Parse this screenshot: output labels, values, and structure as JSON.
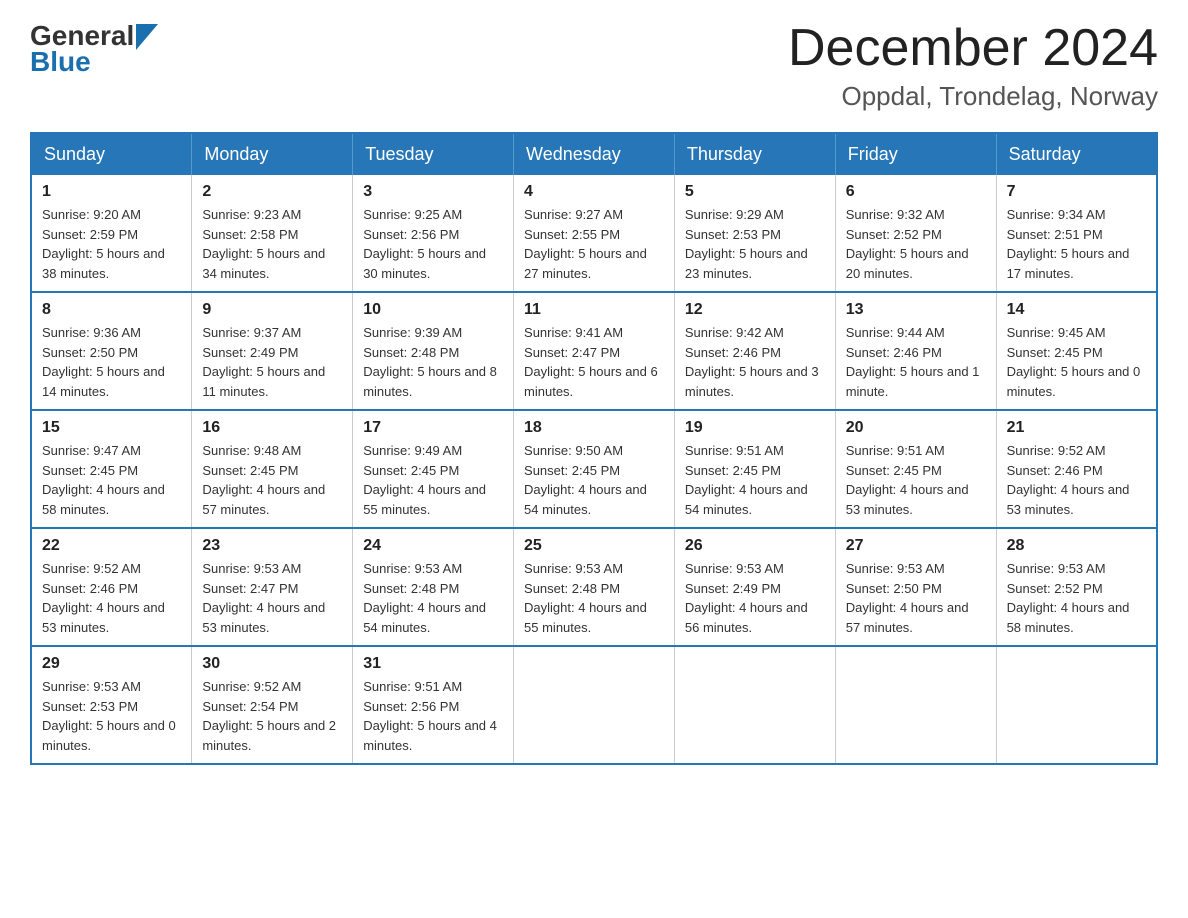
{
  "logo": {
    "general": "General",
    "blue": "Blue"
  },
  "title": {
    "month_year": "December 2024",
    "location": "Oppdal, Trondelag, Norway"
  },
  "weekdays": [
    "Sunday",
    "Monday",
    "Tuesday",
    "Wednesday",
    "Thursday",
    "Friday",
    "Saturday"
  ],
  "weeks": [
    [
      {
        "day": "1",
        "sunrise": "9:20 AM",
        "sunset": "2:59 PM",
        "daylight": "5 hours and 38 minutes."
      },
      {
        "day": "2",
        "sunrise": "9:23 AM",
        "sunset": "2:58 PM",
        "daylight": "5 hours and 34 minutes."
      },
      {
        "day": "3",
        "sunrise": "9:25 AM",
        "sunset": "2:56 PM",
        "daylight": "5 hours and 30 minutes."
      },
      {
        "day": "4",
        "sunrise": "9:27 AM",
        "sunset": "2:55 PM",
        "daylight": "5 hours and 27 minutes."
      },
      {
        "day": "5",
        "sunrise": "9:29 AM",
        "sunset": "2:53 PM",
        "daylight": "5 hours and 23 minutes."
      },
      {
        "day": "6",
        "sunrise": "9:32 AM",
        "sunset": "2:52 PM",
        "daylight": "5 hours and 20 minutes."
      },
      {
        "day": "7",
        "sunrise": "9:34 AM",
        "sunset": "2:51 PM",
        "daylight": "5 hours and 17 minutes."
      }
    ],
    [
      {
        "day": "8",
        "sunrise": "9:36 AM",
        "sunset": "2:50 PM",
        "daylight": "5 hours and 14 minutes."
      },
      {
        "day": "9",
        "sunrise": "9:37 AM",
        "sunset": "2:49 PM",
        "daylight": "5 hours and 11 minutes."
      },
      {
        "day": "10",
        "sunrise": "9:39 AM",
        "sunset": "2:48 PM",
        "daylight": "5 hours and 8 minutes."
      },
      {
        "day": "11",
        "sunrise": "9:41 AM",
        "sunset": "2:47 PM",
        "daylight": "5 hours and 6 minutes."
      },
      {
        "day": "12",
        "sunrise": "9:42 AM",
        "sunset": "2:46 PM",
        "daylight": "5 hours and 3 minutes."
      },
      {
        "day": "13",
        "sunrise": "9:44 AM",
        "sunset": "2:46 PM",
        "daylight": "5 hours and 1 minute."
      },
      {
        "day": "14",
        "sunrise": "9:45 AM",
        "sunset": "2:45 PM",
        "daylight": "5 hours and 0 minutes."
      }
    ],
    [
      {
        "day": "15",
        "sunrise": "9:47 AM",
        "sunset": "2:45 PM",
        "daylight": "4 hours and 58 minutes."
      },
      {
        "day": "16",
        "sunrise": "9:48 AM",
        "sunset": "2:45 PM",
        "daylight": "4 hours and 57 minutes."
      },
      {
        "day": "17",
        "sunrise": "9:49 AM",
        "sunset": "2:45 PM",
        "daylight": "4 hours and 55 minutes."
      },
      {
        "day": "18",
        "sunrise": "9:50 AM",
        "sunset": "2:45 PM",
        "daylight": "4 hours and 54 minutes."
      },
      {
        "day": "19",
        "sunrise": "9:51 AM",
        "sunset": "2:45 PM",
        "daylight": "4 hours and 54 minutes."
      },
      {
        "day": "20",
        "sunrise": "9:51 AM",
        "sunset": "2:45 PM",
        "daylight": "4 hours and 53 minutes."
      },
      {
        "day": "21",
        "sunrise": "9:52 AM",
        "sunset": "2:46 PM",
        "daylight": "4 hours and 53 minutes."
      }
    ],
    [
      {
        "day": "22",
        "sunrise": "9:52 AM",
        "sunset": "2:46 PM",
        "daylight": "4 hours and 53 minutes."
      },
      {
        "day": "23",
        "sunrise": "9:53 AM",
        "sunset": "2:47 PM",
        "daylight": "4 hours and 53 minutes."
      },
      {
        "day": "24",
        "sunrise": "9:53 AM",
        "sunset": "2:48 PM",
        "daylight": "4 hours and 54 minutes."
      },
      {
        "day": "25",
        "sunrise": "9:53 AM",
        "sunset": "2:48 PM",
        "daylight": "4 hours and 55 minutes."
      },
      {
        "day": "26",
        "sunrise": "9:53 AM",
        "sunset": "2:49 PM",
        "daylight": "4 hours and 56 minutes."
      },
      {
        "day": "27",
        "sunrise": "9:53 AM",
        "sunset": "2:50 PM",
        "daylight": "4 hours and 57 minutes."
      },
      {
        "day": "28",
        "sunrise": "9:53 AM",
        "sunset": "2:52 PM",
        "daylight": "4 hours and 58 minutes."
      }
    ],
    [
      {
        "day": "29",
        "sunrise": "9:53 AM",
        "sunset": "2:53 PM",
        "daylight": "5 hours and 0 minutes."
      },
      {
        "day": "30",
        "sunrise": "9:52 AM",
        "sunset": "2:54 PM",
        "daylight": "5 hours and 2 minutes."
      },
      {
        "day": "31",
        "sunrise": "9:51 AM",
        "sunset": "2:56 PM",
        "daylight": "5 hours and 4 minutes."
      },
      null,
      null,
      null,
      null
    ]
  ]
}
